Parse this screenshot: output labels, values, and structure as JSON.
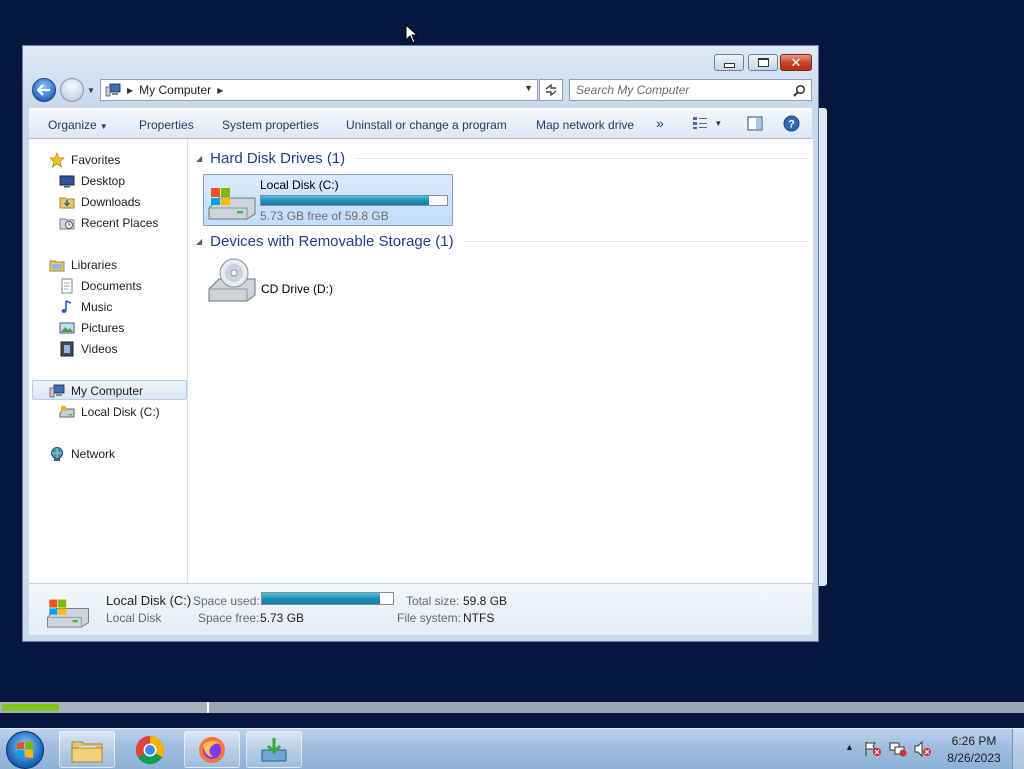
{
  "window": {
    "breadcrumb": [
      "My Computer"
    ],
    "search_placeholder": "Search My Computer"
  },
  "toolbar": {
    "organize": "Organize",
    "properties": "Properties",
    "system_properties": "System properties",
    "uninstall": "Uninstall or change a program",
    "map_drive": "Map network drive",
    "more": "»"
  },
  "nav": {
    "favorites": "Favorites",
    "desktop": "Desktop",
    "downloads": "Downloads",
    "recent_places": "Recent Places",
    "libraries": "Libraries",
    "documents": "Documents",
    "music": "Music",
    "pictures": "Pictures",
    "videos": "Videos",
    "my_computer": "My Computer",
    "local_disk": "Local Disk (C:)",
    "network": "Network"
  },
  "content": {
    "group_hdd": "Hard Disk Drives (1)",
    "group_removable": "Devices with Removable Storage (1)",
    "drive_c": {
      "name": "Local Disk (C:)",
      "free_text": "5.73 GB free of 59.8 GB",
      "used_fraction": 0.904
    },
    "drive_d": {
      "name": "CD Drive (D:)"
    }
  },
  "details": {
    "name": "Local Disk (C:)",
    "type": "Local Disk",
    "space_used_label": "Space used:",
    "space_free_label": "Space free:",
    "space_free_value": "5.73 GB",
    "total_size_label": "Total size:",
    "total_size_value": "59.8 GB",
    "file_system_label": "File system:",
    "file_system_value": "NTFS",
    "used_fraction": 0.904
  },
  "progress": {
    "fraction": 0.28
  },
  "tray": {
    "time": "6:26 PM",
    "date": "8/26/2023"
  },
  "colors": {
    "desktop": "#05173f",
    "accent": "#1e3f8f",
    "progress": "#7ec51c"
  }
}
